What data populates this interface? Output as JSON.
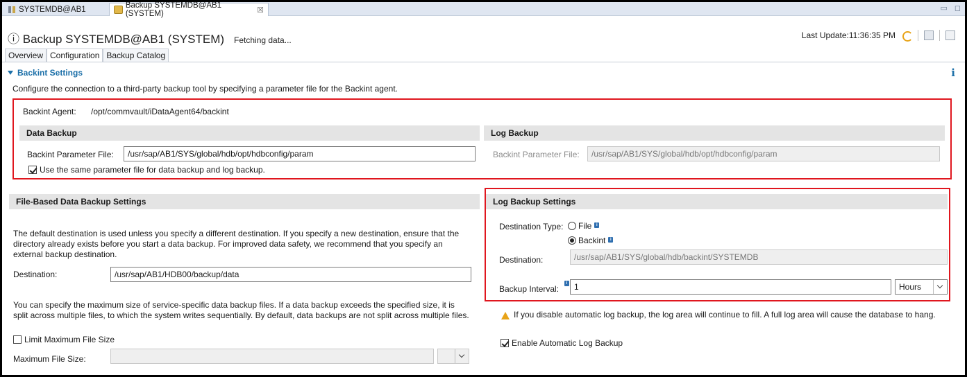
{
  "tabs": {
    "inactive_label": "SYSTEMDB@AB1",
    "active_label": "Backup SYSTEMDB@AB1 (SYSTEM)",
    "close_glyph": "☒"
  },
  "header": {
    "title": "Backup SYSTEMDB@AB1 (SYSTEM)",
    "status": "Fetching data...",
    "last_update": "Last Update:11:36:35 PM"
  },
  "page_tabs": [
    "Overview",
    "Configuration",
    "Backup Catalog"
  ],
  "backint": {
    "heading": "Backint Settings",
    "description": "Configure the connection to a third-party backup tool by specifying a parameter file for the Backint agent.",
    "agent_label": "Backint Agent:",
    "agent_value": "/opt/commvault/iDataAgent64/backint",
    "data_backup": {
      "heading": "Data Backup",
      "param_label": "Backint Parameter File:",
      "param_value": "/usr/sap/AB1/SYS/global/hdb/opt/hdbconfig/param",
      "same_file_label": "Use the same parameter file for data backup and log backup.",
      "same_file_checked": true
    },
    "log_backup": {
      "heading": "Log Backup",
      "param_label": "Backint Parameter File:",
      "param_value": "/usr/sap/AB1/SYS/global/hdb/opt/hdbconfig/param"
    }
  },
  "file_based": {
    "heading": "File-Based Data Backup Settings",
    "intro": "The default destination is used unless you specify a different destination. If you specify a new destination, ensure that the directory already exists before you start a data backup. For improved data safety, we recommend that you specify an external backup destination.",
    "destination_label": "Destination:",
    "destination_value": "/usr/sap/AB1/HDB00/backup/data",
    "size_text": "You can specify the maximum size of service-specific data backup files. If a data backup exceeds the specified size, it is split across multiple files, to which the system writes sequentially. By default, data backups are not split across multiple files.",
    "limit_label": "Limit Maximum File Size",
    "limit_checked": false,
    "max_size_label": "Maximum File Size:",
    "max_size_value": ""
  },
  "log_settings": {
    "heading": "Log Backup Settings",
    "dest_type_label": "Destination Type:",
    "option_file": "File",
    "option_backint": "Backint",
    "selected": "Backint",
    "destination_label": "Destination:",
    "destination_value": "/usr/sap/AB1/SYS/global/hdb/backint/SYSTEMDB",
    "interval_label": "Backup Interval:",
    "interval_value": "1",
    "interval_unit": "Hours",
    "warning": "If you disable automatic log backup, the log area will continue to fill. A full log area will cause the database to hang.",
    "enable_label": "Enable Automatic Log Backup",
    "enable_checked": true
  },
  "colors": {
    "highlight": "#e0161e",
    "link": "#1b6fa8",
    "warning": "#e8a317"
  }
}
